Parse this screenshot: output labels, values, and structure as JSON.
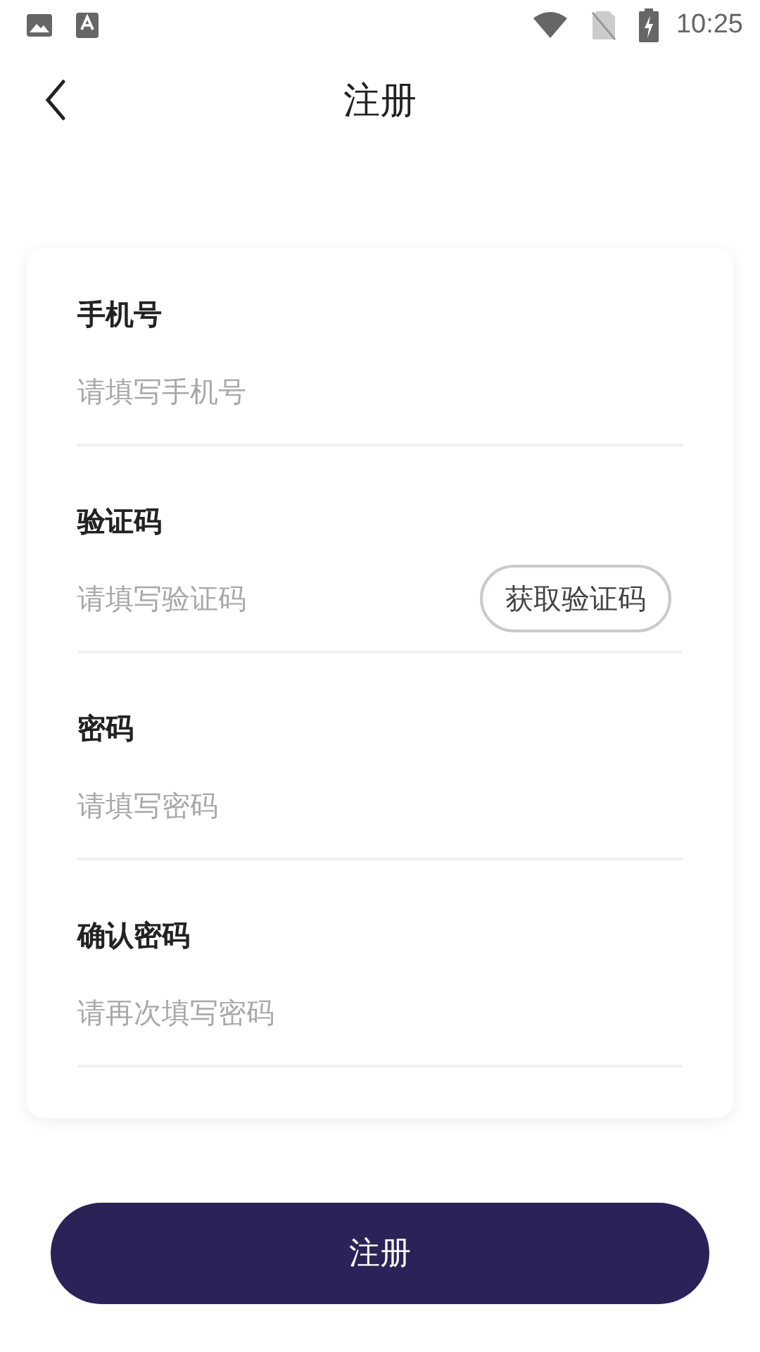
{
  "status_bar": {
    "time": "10:25"
  },
  "header": {
    "title": "注册"
  },
  "fields": [
    {
      "kind": "text",
      "label": "手机号",
      "placeholder": "请填写手机号"
    },
    {
      "kind": "code",
      "label": "验证码",
      "placeholder": "请填写验证码",
      "button": "获取验证码"
    },
    {
      "kind": "password",
      "label": "密码",
      "placeholder": "请填写密码"
    },
    {
      "kind": "password",
      "label": "确认密码",
      "placeholder": "请再次填写密码"
    }
  ],
  "submit": "注册"
}
